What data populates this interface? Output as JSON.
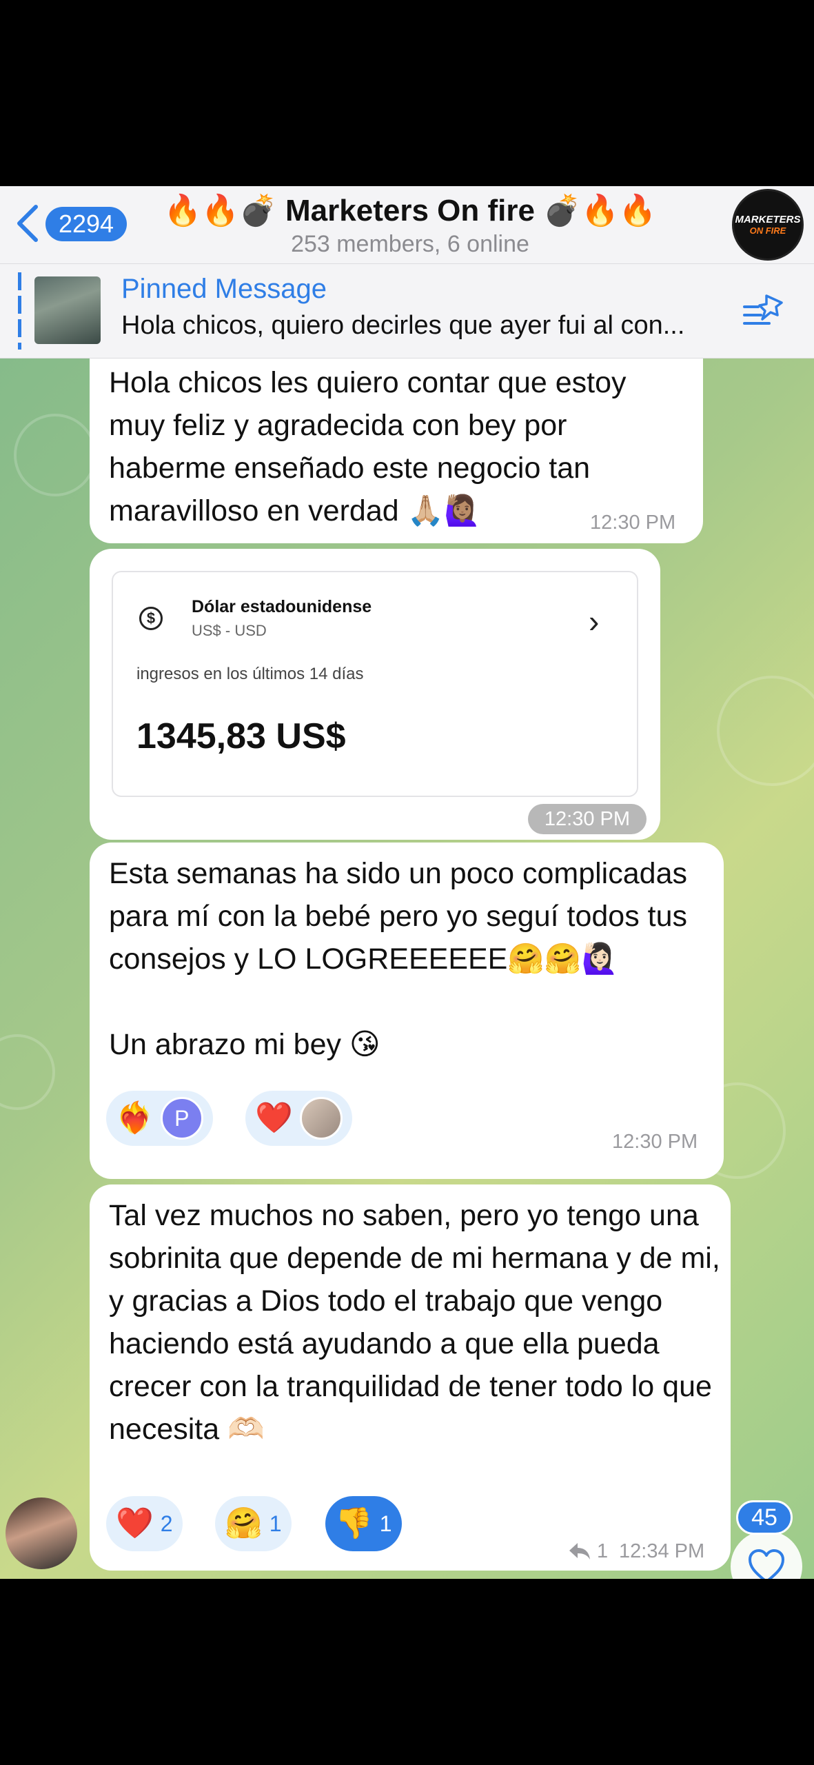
{
  "header": {
    "back_count": "2294",
    "title": "🔥🔥💣 Marketers On fire 💣🔥🔥",
    "subtitle": "253 members, 6 online",
    "avatar_line1": "MARKETERS",
    "avatar_line2": "ON FIRE"
  },
  "pinned": {
    "title": "Pinned Message",
    "text": "Hola chicos, quiero decirles que ayer fui al con..."
  },
  "messages": [
    {
      "text": "Hola chicos les quiero contar que estoy muy feliz y agradecida con bey por haberme enseñado este negocio tan maravilloso en verdad 🙏🏼🙋🏽‍♀️",
      "time": "12:30 PM"
    },
    {
      "card": {
        "currency_name": "Dólar estadounidense",
        "currency_code": "US$ - USD",
        "label": "ingresos en los últimos 14 días",
        "amount": "1345,83 US$"
      },
      "time": "12:30 PM"
    },
    {
      "text_line1": "Esta semanas ha sido un poco complicadas para mí con la bebé pero yo seguí todos tus consejos y LO LOGREEEEEE🤗🤗🙋🏻‍♀️",
      "text_line2": "Un abrazo mi bey 😘",
      "reactions": [
        {
          "emoji": "❤️‍🔥",
          "avatar": "P"
        },
        {
          "emoji": "❤️"
        }
      ],
      "time": "12:30 PM"
    },
    {
      "text": "Tal vez muchos no saben, pero yo tengo una sobrinita que depende de mi hermana y de mi, y gracias a Dios todo el trabajo que vengo haciendo está ayudando a que ella pueda crecer con la tranquilidad de tener todo lo que necesita 🫶🏻",
      "reactions": [
        {
          "emoji": "❤️",
          "count": "2"
        },
        {
          "emoji": "🤗",
          "count": "1"
        },
        {
          "emoji": "👎",
          "count": "1"
        }
      ],
      "replies": "1",
      "time": "12:34 PM"
    }
  ],
  "fab": {
    "count": "45",
    "icon": "heart-icon"
  },
  "colors": {
    "accent": "#2f7ee6",
    "bubble": "#ffffff",
    "header_bg": "#f4f4f6"
  }
}
